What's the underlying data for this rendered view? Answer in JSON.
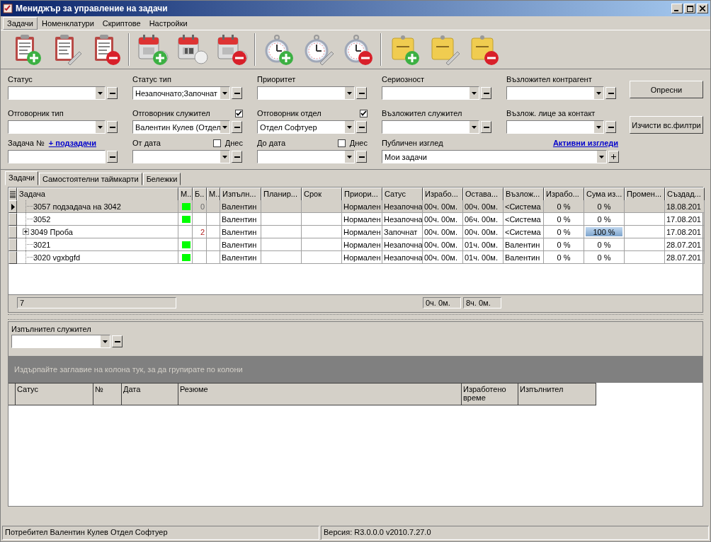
{
  "window": {
    "title": "Мениджър за управление на задачи"
  },
  "menu": [
    {
      "label": "Задачи",
      "selected": true
    },
    {
      "label": "Номенклатури",
      "selected": false
    },
    {
      "label": "Скриптове",
      "selected": false
    },
    {
      "label": "Настройки",
      "selected": false
    }
  ],
  "filters": {
    "rows": [
      [
        {
          "kind": "combo",
          "label": "Статус"
        },
        {
          "kind": "combo",
          "label": "Статус тип",
          "value": "Незапочнато;Започнат"
        },
        {
          "kind": "combo",
          "label": "Приоритет"
        },
        {
          "kind": "combo",
          "label": "Сериозност"
        },
        {
          "kind": "combo",
          "label": "Възложител контрагент"
        }
      ],
      [
        {
          "kind": "combo",
          "label": "Отговорник тип"
        },
        {
          "kind": "combo",
          "label": "Отговорник служител",
          "checked": true,
          "value": "Валентин Кулев (Отдел"
        },
        {
          "kind": "combo",
          "label": "Отговорник отдел",
          "checked": true,
          "value": "Отдел Софтуер"
        },
        {
          "kind": "combo",
          "label": "Възложител служител"
        },
        {
          "kind": "combo",
          "label": "Възлож. лице за контакт"
        }
      ],
      [
        {
          "kind": "text",
          "label": "Задача №",
          "link": "+ подзадачи"
        },
        {
          "kind": "combo",
          "label": "От дата",
          "checked": false,
          "check_label": "Днес"
        },
        {
          "kind": "combo",
          "label": "До дата",
          "checked": false,
          "check_label": "Днес"
        },
        {
          "kind": "view",
          "label": "Публичен изглед",
          "link": "Активни изгледи",
          "value": "Мои задачи"
        }
      ]
    ],
    "buttons": [
      "Опресни",
      "Изчисти вс.филтри"
    ]
  },
  "tabs": [
    {
      "label": "Задачи",
      "selected": true
    },
    {
      "label": "Самостоятелни таймкарти",
      "selected": false
    },
    {
      "label": "Бележки",
      "selected": false
    }
  ],
  "table": {
    "columns": [
      {
        "kind": "task",
        "label": "Задача"
      },
      {
        "kind": "flag",
        "label": "М.."
      },
      {
        "kind": "count",
        "label": "Б.."
      },
      {
        "kind": "blank",
        "label": "М.."
      },
      {
        "kind": "executor",
        "label": "Изпълн..."
      },
      {
        "kind": "blank",
        "label": "Планир..."
      },
      {
        "kind": "blank",
        "label": "Срок"
      },
      {
        "kind": "priority",
        "label": "Приори..."
      },
      {
        "kind": "status",
        "label": "Сатус"
      },
      {
        "kind": "worked",
        "label": "Израбо..."
      },
      {
        "kind": "remaining",
        "label": "Остава..."
      },
      {
        "kind": "assigner",
        "label": "Възлож..."
      },
      {
        "kind": "worked_pct",
        "label": "Израбо..."
      },
      {
        "kind": "sum",
        "label": "Сума из..."
      },
      {
        "kind": "blank",
        "label": "Промен..."
      },
      {
        "kind": "created",
        "label": "Създад..."
      }
    ],
    "rows": [
      {
        "selected": true,
        "expandable": false,
        "task": "3057 подзадача на 3042",
        "flag": true,
        "count": "0",
        "executor": "Валентин",
        "priority": "Нормален",
        "status": "Незапочна",
        "worked": "00ч.  00м.",
        "remaining": "00ч.  00м.",
        "assigner": "<Система",
        "worked_pct": "0 %",
        "sum": "0 %",
        "level": 0,
        "created": "18.08.201"
      },
      {
        "selected": false,
        "expandable": false,
        "task": "3052",
        "flag": true,
        "executor": "Валентин",
        "priority": "Нормален",
        "status": "Незапочна",
        "worked": "00ч.  00м.",
        "remaining": "06ч.  00м.",
        "assigner": "<Система",
        "worked_pct": "0 %",
        "sum": "0 %",
        "level": 0,
        "created": "17.08.201"
      },
      {
        "selected": false,
        "expandable": true,
        "task": "3049 Проба",
        "flag": false,
        "count": "2",
        "executor": "Валентин",
        "priority": "Нормален",
        "status": "Започнат",
        "worked": "00ч.  00м.",
        "remaining": "00ч.  00м.",
        "assigner": "<Система",
        "worked_pct": "0 %",
        "sum": "100 %",
        "level": 1,
        "created": "17.08.201"
      },
      {
        "selected": false,
        "expandable": false,
        "task": "3021",
        "flag": true,
        "executor": "Валентин",
        "priority": "Нормален",
        "status": "Незапочна",
        "worked": "00ч.  00м.",
        "remaining": "01ч.  00м.",
        "assigner": "Валентин",
        "worked_pct": "0 %",
        "sum": "0 %",
        "level": 0,
        "created": "28.07.201"
      },
      {
        "selected": false,
        "expandable": false,
        "task": "3020 vgxbgfd",
        "flag": true,
        "executor": "Валентин",
        "priority": "Нормален",
        "status": "Незапочна",
        "worked": "00ч.  00м.",
        "remaining": "01ч.  00м.",
        "assigner": "Валентин",
        "worked_pct": "0 %",
        "sum": "0 %",
        "level": 0,
        "created": "28.07.201"
      }
    ],
    "footer": {
      "count": "7",
      "worked_total": "0ч.  0м.",
      "remaining_total": "8ч.  0м."
    }
  },
  "timecards": {
    "filter": {
      "label": "Изпълнител служител"
    },
    "group_hint": "Издърпайте заглавие на колона тук, за да групирате по колони",
    "columns": [
      "Сатус",
      "№",
      "Дата",
      "Резюме",
      "Изработено време",
      "Изпълнител"
    ]
  },
  "status_bar": [
    "Потребител Валентин Кулев Отдел Софтуер",
    "Версия: R3.0.0.0 v2010.7.27.0"
  ]
}
